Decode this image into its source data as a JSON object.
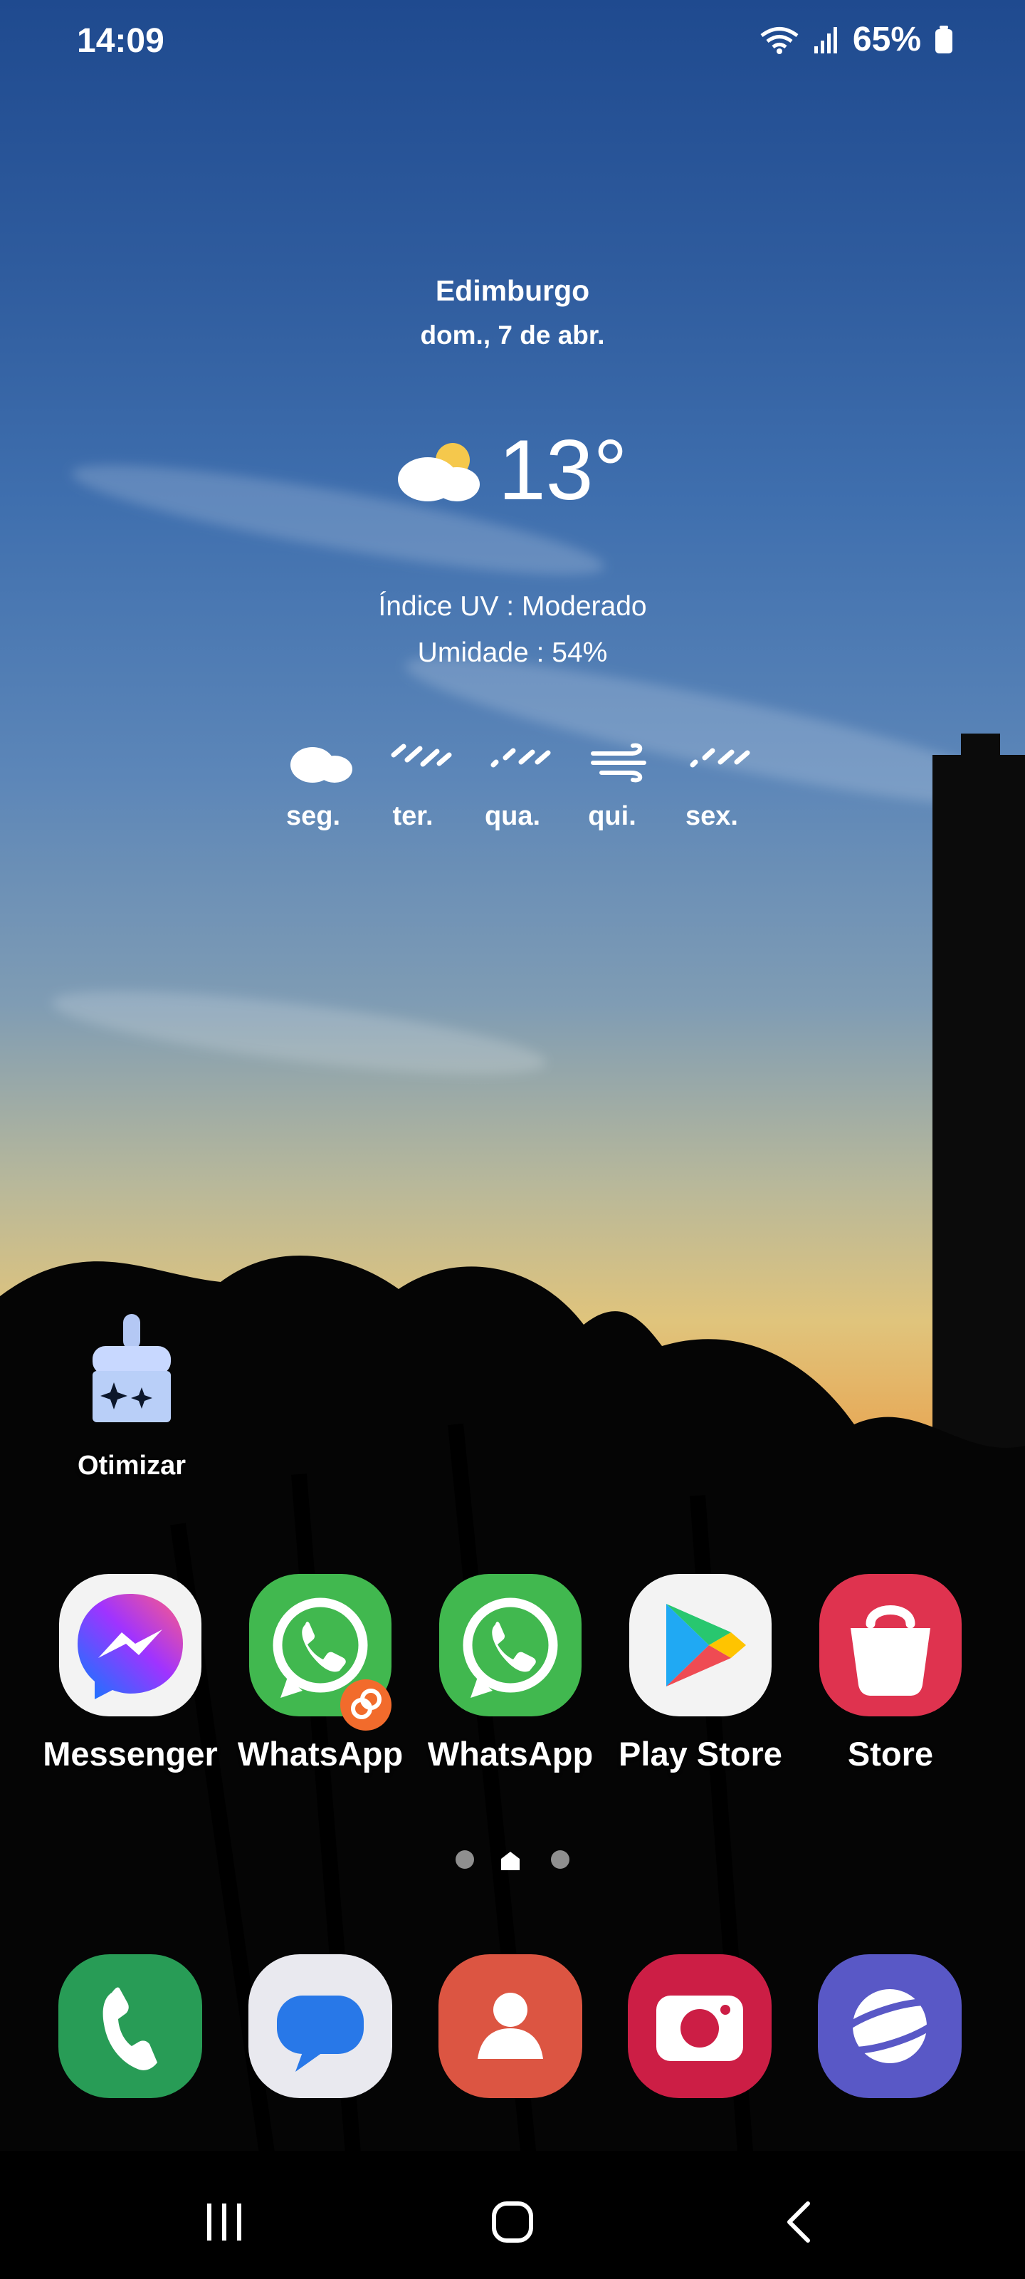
{
  "status_bar": {
    "time": "14:09",
    "battery": "65%",
    "icons": [
      "wifi-icon",
      "signal-icon",
      "battery-icon"
    ]
  },
  "weather": {
    "city": "Edimburgo",
    "date": "dom., 7 de abr.",
    "temperature": "13°",
    "current_icon": "partly-cloudy-icon",
    "uv": "Índice UV : Moderado",
    "humidity": "Umidade : 54%",
    "forecast": [
      {
        "day": "seg.",
        "icon": "cloud-icon"
      },
      {
        "day": "ter.",
        "icon": "rain-icon"
      },
      {
        "day": "qua.",
        "icon": "rain-icon"
      },
      {
        "day": "qui.",
        "icon": "wind-icon"
      },
      {
        "day": "sex.",
        "icon": "rain-icon"
      }
    ]
  },
  "shortcut": {
    "label": "Otimizar",
    "icon": "broom-sparkle-icon"
  },
  "apps": [
    {
      "label": "Messenger",
      "icon": "messenger-icon",
      "color": "#f3f3f3"
    },
    {
      "label": "WhatsApp",
      "icon": "whatsapp-icon",
      "color": "#41b84f",
      "badge": "dual-messenger-icon"
    },
    {
      "label": "WhatsApp",
      "icon": "whatsapp-icon",
      "color": "#41b84f"
    },
    {
      "label": "Play Store",
      "icon": "play-store-icon",
      "color": "#f3f3f3"
    },
    {
      "label": "Store",
      "icon": "shopping-bag-icon",
      "color": "#df334f"
    }
  ],
  "page_indicator": {
    "current": 2,
    "total": 3,
    "home_icon": "home-icon"
  },
  "dock": [
    {
      "name": "phone-icon",
      "color": "#289c56"
    },
    {
      "name": "messages-icon",
      "color": "#e9e9ef"
    },
    {
      "name": "contacts-icon",
      "color": "#dc5542"
    },
    {
      "name": "camera-icon",
      "color": "#cc1e45"
    },
    {
      "name": "browser-icon",
      "color": "#5958c6"
    }
  ],
  "navigation": {
    "recents": "recent-apps-icon",
    "home": "home-button-icon",
    "back": "back-icon"
  }
}
